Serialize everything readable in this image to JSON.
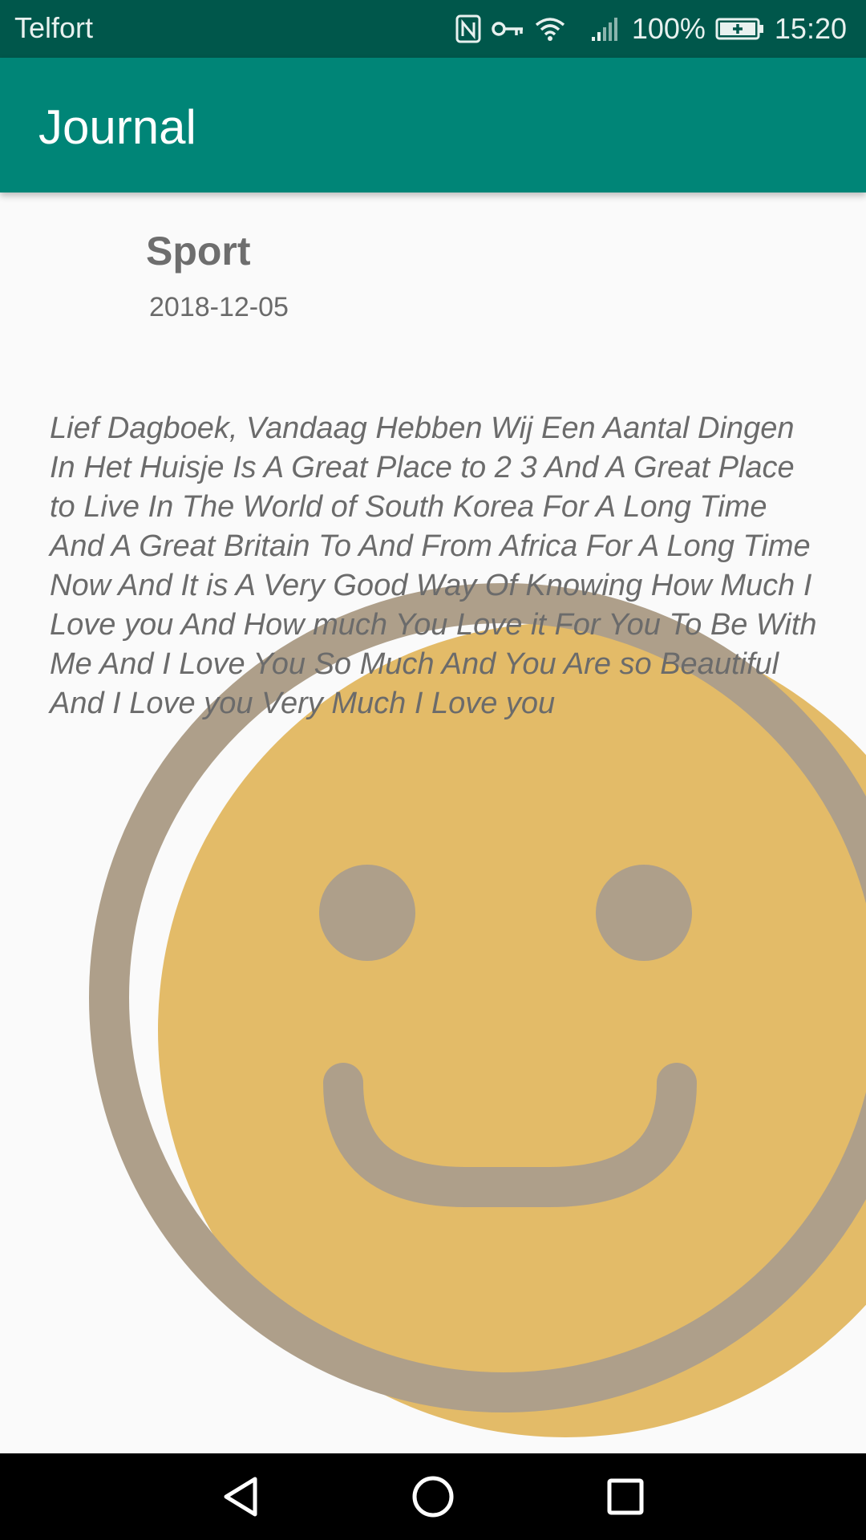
{
  "status_bar": {
    "carrier": "Telfort",
    "battery": "100%",
    "time": "15:20",
    "icons": [
      "nfc-icon",
      "vpn-key-icon",
      "wifi-icon",
      "signal-icon",
      "battery-charging-icon"
    ]
  },
  "app_bar": {
    "title": "Journal"
  },
  "entry": {
    "title": "Sport",
    "date": "2018-12-05",
    "body": "Lief Dagboek, Vandaag Hebben Wij Een Aantal Dingen In Het Huisje Is A Great Place to 2 3 And A Great Place to Live In The World of South Korea For A Long Time And A Great Britain To And From Africa For A Long Time Now And It is A Very Good Way Of Knowing How Much I Love you And How much You Love it For You To Be With Me And I Love You So Much And You Are so Beautiful And I Love you Very Much I Love you",
    "mood_icon": "smiley-face-icon"
  },
  "nav_bar": {
    "icons": [
      "back-icon",
      "home-icon",
      "recents-icon"
    ]
  },
  "colors": {
    "status_bar": "#00574b",
    "app_bar": "#008577",
    "smiley_face": "#e3bb68",
    "smiley_outline": "#ae9f8a",
    "background": "#fafafa"
  }
}
